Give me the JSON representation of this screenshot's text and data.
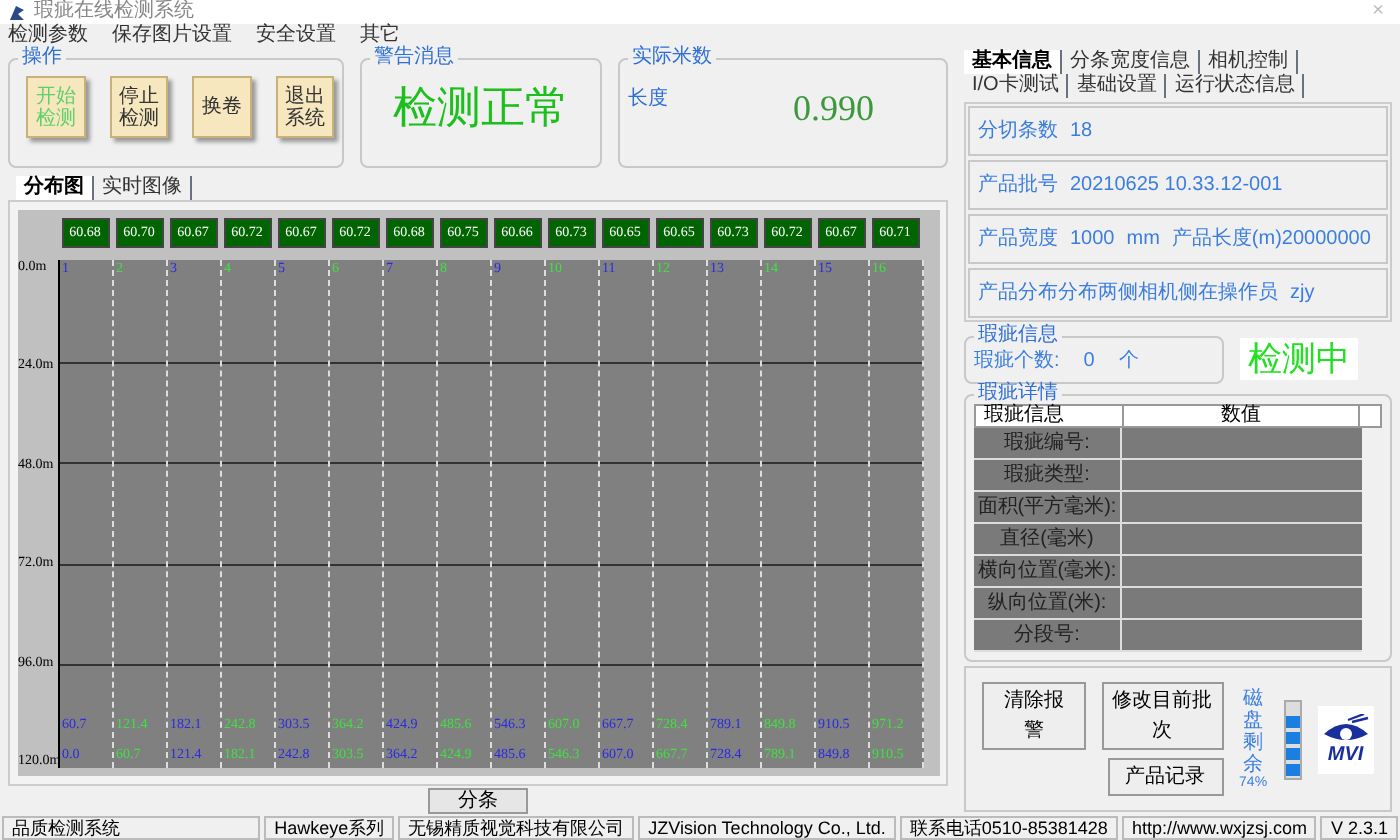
{
  "window": {
    "title": "瑕疵在线检测系统",
    "close": "×"
  },
  "menu": [
    "检测参数",
    "保存图片设置",
    "安全设置",
    "其它"
  ],
  "operation": {
    "title": "操作",
    "buttons": [
      {
        "lines": [
          "开始",
          "检测"
        ],
        "disabled": true
      },
      {
        "lines": [
          "停止",
          "检测"
        ],
        "disabled": false
      },
      {
        "lines": [
          "换卷"
        ],
        "disabled": false
      },
      {
        "lines": [
          "退出",
          "系统"
        ],
        "disabled": false
      }
    ]
  },
  "warning": {
    "title": "警告消息",
    "message": "检测正常"
  },
  "meter": {
    "title": "实际米数",
    "label": "长度",
    "value": "0.990"
  },
  "view_tabs": [
    {
      "label": "分布图",
      "selected": true
    },
    {
      "label": "实时图像",
      "selected": false
    }
  ],
  "distribution": {
    "lane_values": [
      "60.68",
      "60.70",
      "60.67",
      "60.72",
      "60.67",
      "60.72",
      "60.68",
      "60.75",
      "60.66",
      "60.73",
      "60.65",
      "60.65",
      "60.73",
      "60.72",
      "60.67",
      "60.71"
    ],
    "lane_numbers": [
      "1",
      "2",
      "3",
      "4",
      "5",
      "6",
      "7",
      "8",
      "9",
      "10",
      "11",
      "12",
      "13",
      "14",
      "15",
      "16"
    ],
    "y_labels": [
      "0.0m",
      "24.0m",
      "48.0m",
      "72.0m",
      "96.0m",
      "120.0m"
    ],
    "lane_end": [
      "60.7",
      "121.4",
      "182.1",
      "242.8",
      "303.5",
      "364.2",
      "424.9",
      "485.6",
      "546.3",
      "607.0",
      "667.7",
      "728.4",
      "789.1",
      "849.8",
      "910.5",
      "971.2"
    ],
    "lane_start": [
      "0.0",
      "60.7",
      "121.4",
      "182.1",
      "242.8",
      "303.5",
      "364.2",
      "424.9",
      "485.6",
      "546.3",
      "607.0",
      "667.7",
      "728.4",
      "789.1",
      "849.8",
      "910.5"
    ]
  },
  "split_button": "分条",
  "right_tabs": [
    {
      "label": "基本信息",
      "selected": true
    },
    {
      "label": "分条宽度信息",
      "selected": false
    },
    {
      "label": "相机控制",
      "selected": false
    },
    {
      "label": "I/O卡测试",
      "selected": false
    },
    {
      "label": "基础设置",
      "selected": false
    },
    {
      "label": "运行状态信息",
      "selected": false
    }
  ],
  "basic_info": [
    [
      "分切条数",
      "18"
    ],
    [
      "产品批号",
      "20210625  10.33.12-001"
    ],
    [
      "产品宽度",
      "1000",
      "mm",
      "产品长度(m)20000000"
    ],
    [
      "产品分布分布两侧相机侧在操作员",
      "zjy"
    ]
  ],
  "defect_info": {
    "title": "瑕疵信息",
    "label": "瑕疵个数:",
    "count": "0",
    "unit": "个",
    "status": "检测中"
  },
  "defect_detail": {
    "title": "瑕疵详情",
    "columns": [
      "瑕疵信息",
      "数值"
    ],
    "rows": [
      "瑕疵编号:",
      "瑕疵类型:",
      "面积(平方毫米):",
      "直径(毫米)",
      "横向位置(毫米):",
      "纵向位置(米):",
      "分段号:"
    ]
  },
  "actions": [
    "清除报警",
    "修改目前批次",
    "产品记录"
  ],
  "disk": {
    "label": "磁盘剩余",
    "reading": "74%",
    "level": 0.8
  },
  "logo": {
    "text": "MVI"
  },
  "status_bar": [
    "品质检测系统",
    "Hawkeye系列",
    "无锡精质视觉科技有限公司",
    "JZVision Technology Co., Ltd.",
    "联系电话0510-85381428",
    "http://www.wxjzsj.com",
    "V 2.3.1"
  ]
}
